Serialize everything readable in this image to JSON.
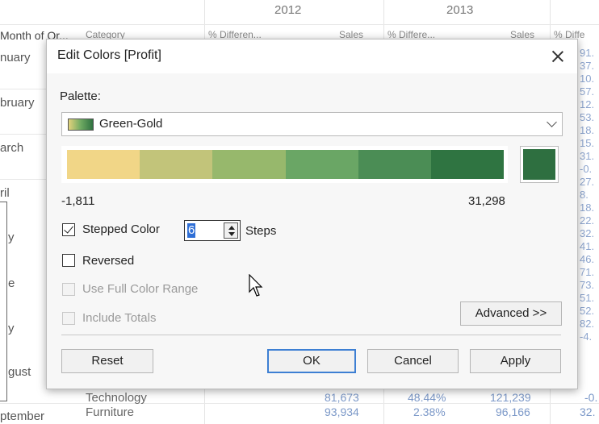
{
  "worksheet": {
    "years": [
      "2012",
      "2013"
    ],
    "headers": [
      "Month of Or...",
      "Category",
      "% Differen...",
      "Sales",
      "% Differe...",
      "Sales",
      "% Diffe"
    ],
    "months": [
      "nuary",
      "bruary",
      "arch",
      "ril",
      "y",
      "e",
      "y",
      "gust",
      "ptember"
    ],
    "bottom_rows": [
      {
        "category": "Technology",
        "sales_2012": "81,673",
        "pct_2013": "48.44%",
        "sales_2013": "121,239",
        "peek": "-0."
      },
      {
        "category": "Furniture",
        "sales_2012": "93,934",
        "pct_2013": "2.38%",
        "sales_2013": "96,166",
        "peek": "32."
      }
    ],
    "right_peek": [
      "91.",
      "37.",
      "10.",
      "57.",
      "12.",
      "53.",
      "18.",
      "15.",
      "31.",
      "-0.",
      "27.",
      "8.",
      "18.",
      "22.",
      "32.",
      "41.",
      "46.",
      "71.",
      "73.",
      "51.",
      "52.",
      "82.",
      "-4."
    ]
  },
  "dialog": {
    "title": "Edit Colors [Profit]",
    "palette_label": "Palette:",
    "palette_value": "Green-Gold",
    "range_min": "-1,811",
    "range_max": "31,298",
    "stepped_label": "Stepped Color",
    "stepped_checked": true,
    "steps_value": "6",
    "steps_label": "Steps",
    "reversed_label": "Reversed",
    "full_range_label": "Use Full Color Range",
    "include_totals_label": "Include Totals",
    "advanced_button": "Advanced >>",
    "reset_button": "Reset",
    "ok_button": "OK",
    "cancel_button": "Cancel",
    "apply_button": "Apply",
    "ramp_colors": [
      "#f1d687",
      "#c2c47a",
      "#97b86c",
      "#6aa665",
      "#4b8d55",
      "#2f7441"
    ],
    "end_color": "#2e6f40",
    "icons": [
      "close-icon",
      "palette-swatch-icon",
      "chevron-down-icon",
      "spin-up-icon",
      "spin-down-icon",
      "mouse-pointer-icon"
    ]
  }
}
